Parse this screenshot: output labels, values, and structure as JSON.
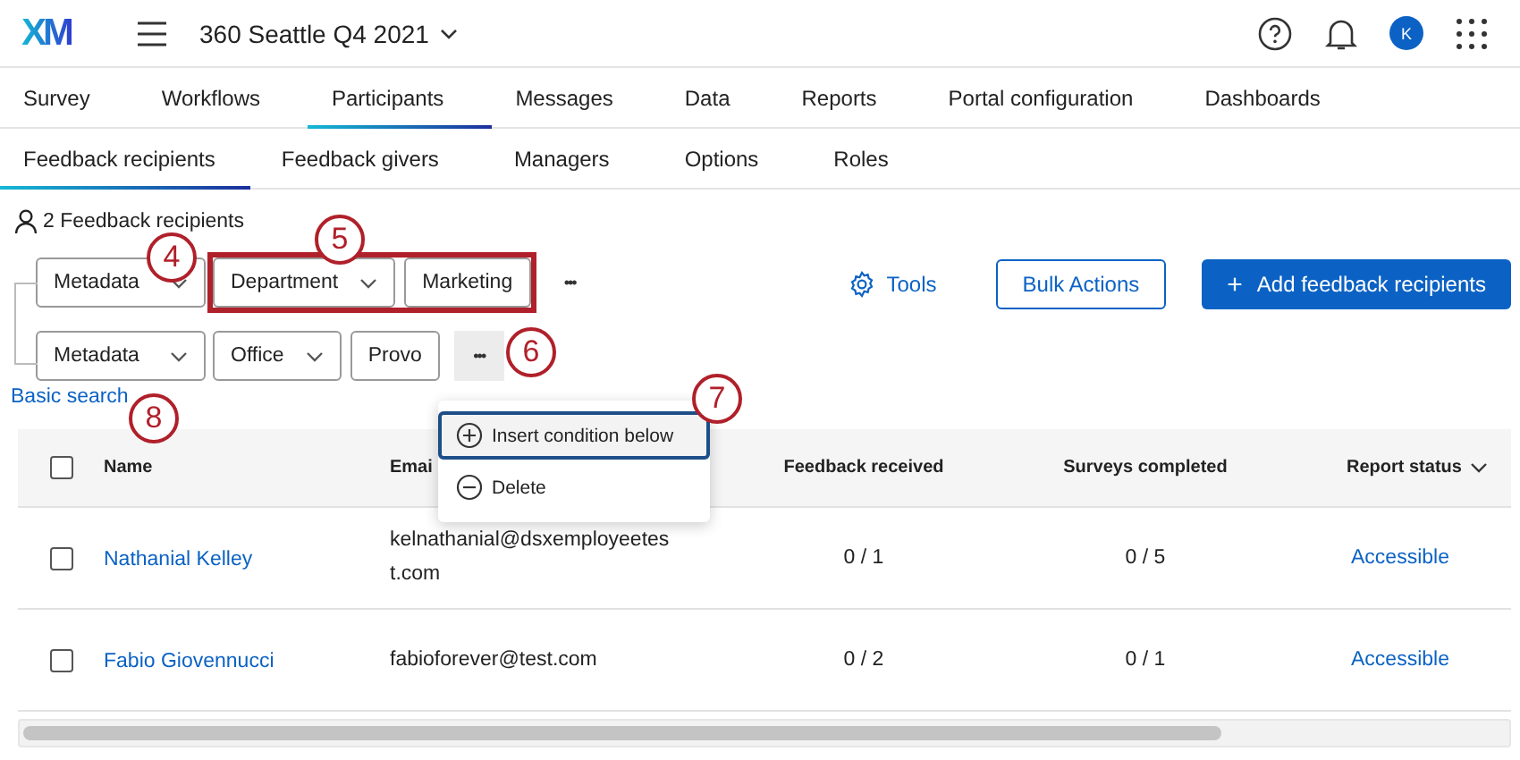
{
  "header": {
    "logo": "XM",
    "project": "360 Seattle Q4 2021",
    "avatar": "K"
  },
  "tabs": [
    {
      "label": "Survey",
      "selected": false
    },
    {
      "label": "Workflows",
      "selected": false
    },
    {
      "label": "Participants",
      "selected": true
    },
    {
      "label": "Messages",
      "selected": false
    },
    {
      "label": "Data",
      "selected": false
    },
    {
      "label": "Reports",
      "selected": false
    },
    {
      "label": "Portal configuration",
      "selected": false
    },
    {
      "label": "Dashboards",
      "selected": false
    }
  ],
  "subtabs": [
    {
      "label": "Feedback recipients",
      "selected": true
    },
    {
      "label": "Feedback givers",
      "selected": false
    },
    {
      "label": "Managers",
      "selected": false
    },
    {
      "label": "Options",
      "selected": false
    },
    {
      "label": "Roles",
      "selected": false
    }
  ],
  "count": "2 Feedback recipients",
  "conditions": [
    {
      "source": "Metadata",
      "field": "Department",
      "value": "Marketing",
      "highlighted": true,
      "menu_open": false,
      "more": "•••"
    },
    {
      "source": "Metadata",
      "field": "Office",
      "value": "Provo",
      "highlighted": false,
      "menu_open": true,
      "more": "•••"
    }
  ],
  "menu": [
    {
      "kind": "insert",
      "label": "Insert condition below",
      "selected": true
    },
    {
      "kind": "delete",
      "label": "Delete",
      "selected": false
    }
  ],
  "basic_search": "Basic search",
  "actions": {
    "tools": "Tools",
    "bulk": "Bulk Actions",
    "add": "Add feedback recipients",
    "add_icon": "+"
  },
  "table": {
    "select_all_checked": false,
    "columns": [
      "Name",
      "Emai",
      "Feedback received",
      "Surveys completed",
      "Report status"
    ],
    "rows": [
      {
        "checked": false,
        "name": "Nathanial Kelley",
        "email": "kelnathanial@dsxemployeetest.com",
        "received": "0 / 1",
        "completed": "0 / 5",
        "status": "Accessible"
      },
      {
        "checked": false,
        "name": "Fabio Giovennucci",
        "email": "fabioforever@test.com",
        "received": "0 / 2",
        "completed": "0 / 1",
        "status": "Accessible"
      }
    ]
  },
  "callouts": [
    "4",
    "5",
    "6",
    "7",
    "8"
  ]
}
